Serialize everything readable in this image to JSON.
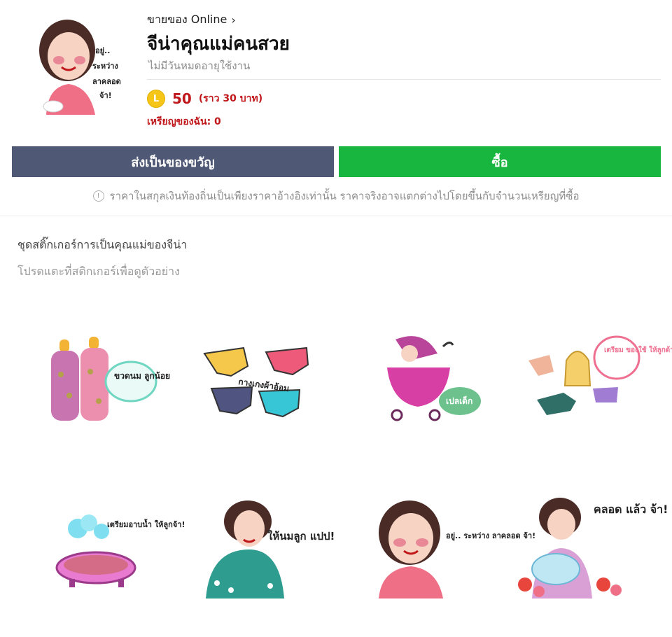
{
  "header": {
    "seller_label": "ขายของ Online",
    "seller_chevron": "›",
    "title": "จีน่าคุณแม่คนสวย",
    "subtitle": "ไม่มีวันหมดอายุใช้งาน",
    "coin_icon_letter": "L",
    "price": "50",
    "price_approx": "(ราว 30 บาท)",
    "my_coins": "เหรียญของฉัน: 0",
    "thumb_caption": "อยู่.. ระหว่าง ลาคลอด จ้า!"
  },
  "buttons": {
    "gift_label": "ส่งเป็นของขวัญ",
    "buy_label": "ซื้อ"
  },
  "notice": "ราคาในสกุลเงินท้องถิ่นเป็นเพียงราคาอ้างอิงเท่านั้น ราคาจริงอาจแตกต่างไปโดยขึ้นกับจำนวนเหรียญที่ซื้อ",
  "description": "ชุดสติ๊กเกอร์การเป็นคุณแม่ของจีน่า",
  "hint": "โปรดแตะที่สติกเกอร์เพื่อดูตัวอย่าง",
  "stickers": [
    {
      "caption": "ขวดนม ลูกน้อย"
    },
    {
      "caption": "กางเกงผ้าอ้อม"
    },
    {
      "caption": "เปลเด็ก"
    },
    {
      "caption": "เตรียม ของใช้ ให้ลูกด้วย"
    },
    {
      "caption": "เตรียมอาบน้ำ ให้ลูกจ้า!"
    },
    {
      "caption": "ให้นมลูก แปป!"
    },
    {
      "caption": "อยู่.. ระหว่าง ลาคลอด จ้า!"
    },
    {
      "caption": "คลอด แล้ว จ้า!"
    }
  ],
  "colors": {
    "gift_button": "#4f5874",
    "buy_button": "#19b63f",
    "price_red": "#c0171b",
    "coin_yellow": "#f5c518"
  }
}
